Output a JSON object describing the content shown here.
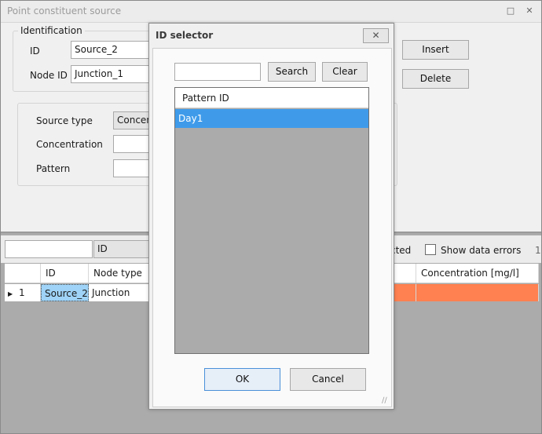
{
  "main": {
    "title": "Point constituent source",
    "identification": {
      "legend": "Identification",
      "id_label": "ID",
      "id_value": "Source_2",
      "node_label": "Node ID",
      "node_value": "Junction_1"
    },
    "buttons": {
      "insert": "Insert",
      "delete": "Delete"
    },
    "source": {
      "type_label": "Source type",
      "type_value": "Concen",
      "concentration_label": "Concentration",
      "pattern_label": "Pattern"
    },
    "filter": {
      "value": "",
      "column": "ID",
      "selected_text": "cted",
      "show_errors_label": "Show data errors",
      "count_text": "1"
    },
    "grid": {
      "columns": [
        "ID",
        "Node type",
        "Concentration [mg/l]"
      ],
      "rows": [
        {
          "index": "1",
          "id": "Source_2",
          "node_type": "Junction"
        }
      ]
    },
    "colors": {
      "row_highlight": "#ff8050",
      "selection_blue": "#3f9bea",
      "id_cell": "#9fd3f7"
    }
  },
  "dialog": {
    "title": "ID selector",
    "search_value": "",
    "search_button": "Search",
    "clear_button": "Clear",
    "list_header": "Pattern ID",
    "items": [
      "Day1"
    ],
    "ok_button": "OK",
    "cancel_button": "Cancel"
  }
}
